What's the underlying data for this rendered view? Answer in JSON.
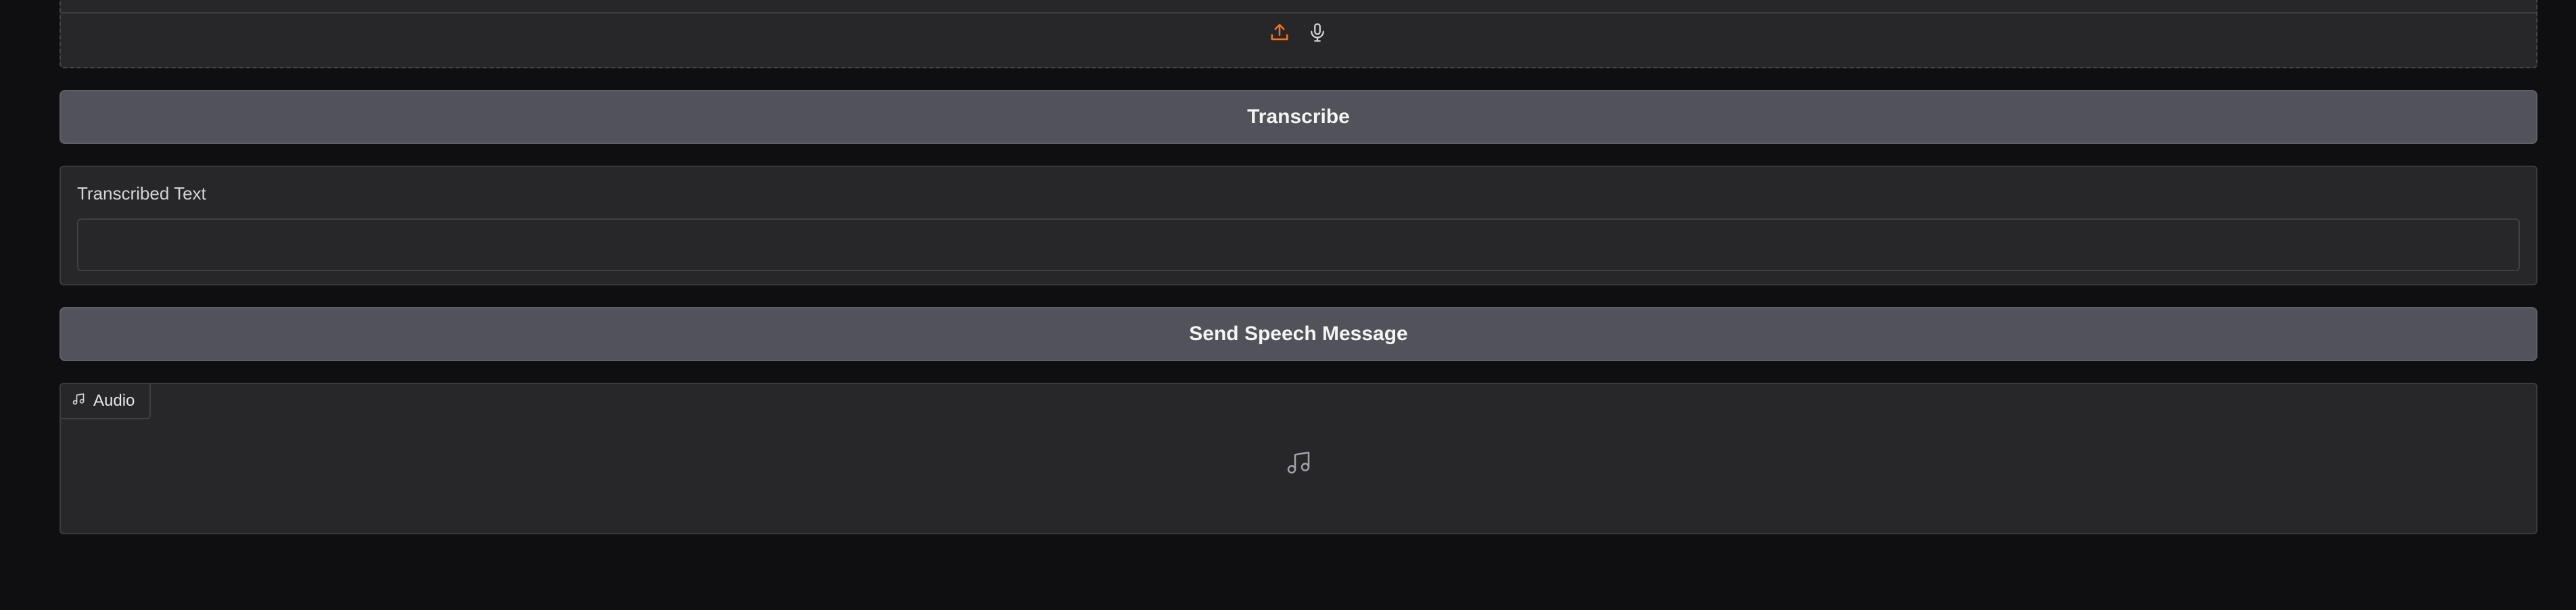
{
  "upload": {
    "upload_icon": "upload-icon",
    "mic_icon": "microphone-icon",
    "accent_color": "#f97316"
  },
  "transcribe_button": {
    "label": "Transcribe"
  },
  "transcribed_text": {
    "label": "Transcribed Text",
    "value": ""
  },
  "send_button": {
    "label": "Send Speech Message"
  },
  "audio": {
    "label": "Audio",
    "icon": "music-note-icon"
  }
}
